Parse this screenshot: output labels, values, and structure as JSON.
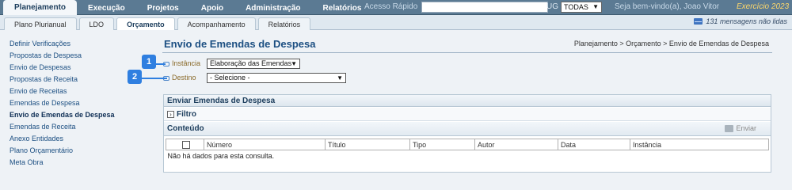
{
  "topnav": {
    "items": [
      "Planejamento",
      "Execução",
      "Projetos",
      "Apoio",
      "Administração",
      "Relatórios"
    ],
    "quick_access_label": "Acesso Rápido",
    "quick_access_value": "",
    "ug_label": "UG",
    "ug_value": "TODAS",
    "welcome": "Seja bem-vindo(a), Joao Vitor",
    "year": "Exercício 2023"
  },
  "subnav": {
    "tabs": [
      "Plano Plurianual",
      "LDO",
      "Orçamento",
      "Acompanhamento",
      "Relatórios"
    ],
    "messages": "131 mensagens não lidas"
  },
  "sidebar": {
    "items": [
      "Definir Verificações",
      "Propostas de Despesa",
      "Envio de Despesas",
      "Propostas de Receita",
      "Envio de Receitas",
      "Emendas de Despesa",
      "Envio de Emendas de Despesa",
      "Emendas de Receita",
      "Anexo Entidades",
      "Plano Orçamentário",
      "Meta Obra"
    ]
  },
  "page": {
    "title": "Envio de Emendas de Despesa",
    "breadcrumb": "Planejamento > Orçamento > Envio de Emendas de Despesa"
  },
  "form": {
    "instancia_label": "Instância",
    "instancia_value": "Elaboração das Emendas",
    "destino_label": "Destino",
    "destino_value": "- Selecione -",
    "badge1": "1",
    "badge2": "2"
  },
  "panel": {
    "title": "Enviar Emendas de Despesa",
    "filter_label": "Filtro",
    "content_label": "Conteúdo",
    "send_label": "Enviar",
    "columns": [
      "",
      "Número",
      "Título",
      "Tipo",
      "Autor",
      "Data",
      "Instância"
    ],
    "empty_message": "Não há dados para esta consulta."
  }
}
